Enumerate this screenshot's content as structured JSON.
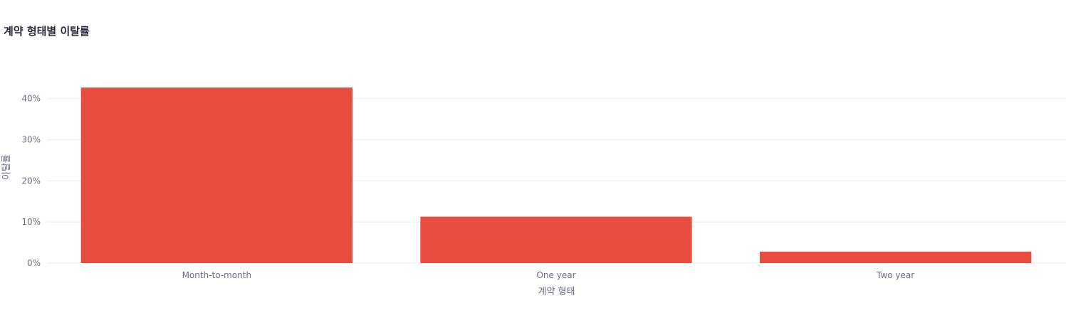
{
  "chart_data": {
    "type": "bar",
    "title": "계약 형태별 이탈률",
    "xlabel": "계약 형태",
    "ylabel": "이탈률",
    "categories": [
      "Month-to-month",
      "One year",
      "Two year"
    ],
    "values": [
      42.7,
      11.3,
      2.8
    ],
    "value_unit": "%",
    "ylim": [
      0,
      46.7
    ],
    "yticks": [
      0,
      10,
      20,
      30,
      40
    ],
    "ytick_labels": [
      "0%",
      "10%",
      "20%",
      "30%",
      "40%"
    ],
    "grid": true,
    "bar_color": "#e84e3f"
  }
}
